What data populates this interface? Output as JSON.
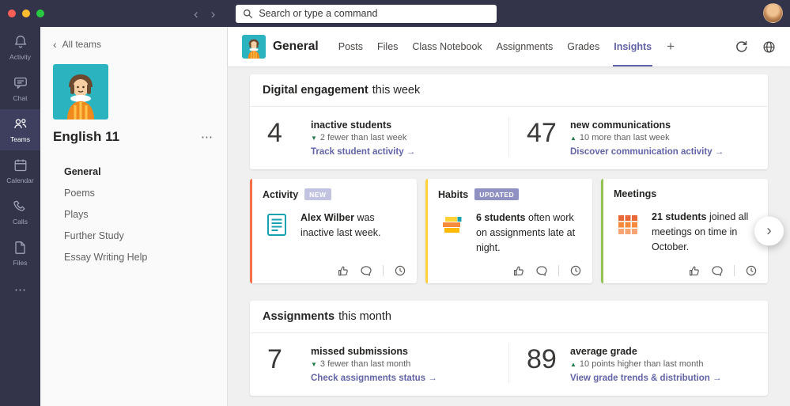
{
  "window": {
    "traffic_lights": [
      "#ff5f57",
      "#febc2e",
      "#28c840"
    ]
  },
  "topbar": {
    "search_placeholder": "Search or type a command",
    "back_icon": "‹",
    "forward_icon": "›"
  },
  "rail": {
    "items": [
      {
        "label": "Activity",
        "icon": "bell-icon"
      },
      {
        "label": "Chat",
        "icon": "chat-icon"
      },
      {
        "label": "Teams",
        "icon": "teams-icon",
        "active": true
      },
      {
        "label": "Calendar",
        "icon": "calendar-icon"
      },
      {
        "label": "Calls",
        "icon": "phone-icon"
      },
      {
        "label": "Files",
        "icon": "file-icon"
      }
    ],
    "more_icon": "⋯"
  },
  "sidebar": {
    "back_chevron": "‹",
    "back_label": "All teams",
    "team_name": "English 11",
    "more_icon": "⋯",
    "channels": [
      {
        "name": "General",
        "active": true
      },
      {
        "name": "Poems"
      },
      {
        "name": "Plays"
      },
      {
        "name": "Further Study"
      },
      {
        "name": "Essay Writing Help"
      }
    ]
  },
  "header": {
    "channel_name": "General",
    "tabs": [
      {
        "label": "Posts"
      },
      {
        "label": "Files"
      },
      {
        "label": "Class Notebook"
      },
      {
        "label": "Assignments"
      },
      {
        "label": "Grades"
      },
      {
        "label": "Insights",
        "active": true
      }
    ],
    "add_tab": "+"
  },
  "engagement": {
    "title": "Digital engagement",
    "subtitle": "this week",
    "stats": [
      {
        "value": "4",
        "label": "inactive students",
        "arrow": "▼",
        "trend": "2 fewer than last week",
        "link": "Track student activity →"
      },
      {
        "value": "47",
        "label": "new communications",
        "arrow": "▲",
        "trend": "10 more than last week",
        "link": "Discover communication activity →"
      }
    ]
  },
  "insight_cards": [
    {
      "title": "Activity",
      "badge": {
        "label": "NEW",
        "bg": "#c2c3e0",
        "fg": "#ffffff"
      },
      "accent": "#f3704a",
      "text_bold": "Alex Wilber",
      "text_rest": " was inactive last week."
    },
    {
      "title": "Habits",
      "badge": {
        "label": "UPDATED",
        "bg": "#9091c3",
        "fg": "#ffffff"
      },
      "accent": "#ffd23e",
      "text_bold": "6 students",
      "text_rest": " often work on assignments late at night."
    },
    {
      "title": "Meetings",
      "badge": {
        "label": "",
        "bg": "",
        "fg": ""
      },
      "accent": "#92c353",
      "text_bold": "21 students",
      "text_rest": " joined all meetings on time in October."
    }
  ],
  "carousel": {
    "next_icon": "›"
  },
  "assignments": {
    "title": "Assignments",
    "subtitle": "this month",
    "stats": [
      {
        "value": "7",
        "label": "missed submissions",
        "arrow": "▼",
        "trend": "3 fewer than last month",
        "link": "Check assignments status →"
      },
      {
        "value": "89",
        "label": "average grade",
        "arrow": "▲",
        "trend": "10 points higher than last month",
        "link": "View grade trends & distribution →"
      }
    ]
  },
  "colors": {
    "accent_purple": "#6264a7",
    "positive_green": "#237b4b",
    "topbar_bg": "#33344a"
  }
}
